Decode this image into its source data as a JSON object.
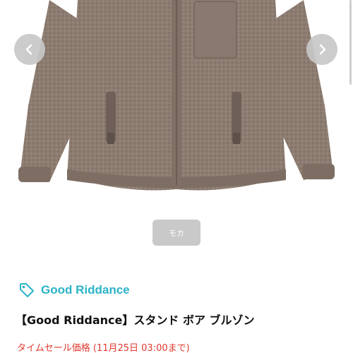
{
  "product": {
    "brand": "Good Riddance",
    "title": "【Good Riddance】スタンド ボア ブルゾン",
    "sale_label": "タイムセール価格 (11月25日 03:00まで)",
    "selected_color": "モカ"
  },
  "colors": {
    "garment": "#8c7b70",
    "accent": "#2bb3c8",
    "sale": "#e0392e",
    "chip": "#c9c9c9"
  },
  "icons": {
    "prev": "chevron-left-icon",
    "next": "chevron-right-icon",
    "brand": "tag-icon"
  }
}
